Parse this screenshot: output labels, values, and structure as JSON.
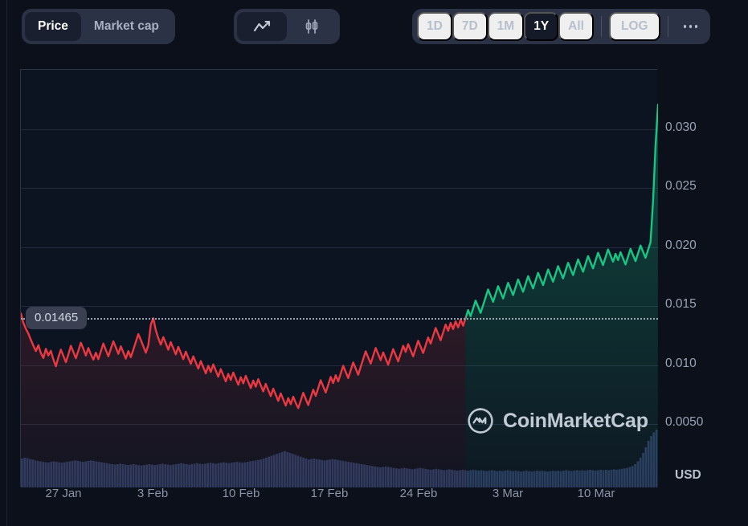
{
  "toolbar": {
    "metric_tabs": [
      {
        "label": "Price",
        "active": true
      },
      {
        "label": "Market cap",
        "active": false
      }
    ],
    "chart_type_icons": [
      {
        "name": "line-chart-icon",
        "active": true
      },
      {
        "name": "candlestick-chart-icon",
        "active": false
      }
    ],
    "ranges": [
      {
        "label": "1D",
        "active": false
      },
      {
        "label": "7D",
        "active": false
      },
      {
        "label": "1M",
        "active": false
      },
      {
        "label": "1Y",
        "active": true
      },
      {
        "label": "All",
        "active": false
      }
    ],
    "log_label": "LOG",
    "more_label": "more-options"
  },
  "chart_data": {
    "type": "line",
    "title": "",
    "xlabel": "",
    "ylabel": "USD",
    "currency": "USD",
    "ylim": [
      0.0025,
      0.0325
    ],
    "yticks": [
      "0.030",
      "0.025",
      "0.020",
      "0.015",
      "0.010",
      "0.0050"
    ],
    "ytick_values": [
      0.03,
      0.025,
      0.02,
      0.015,
      0.01,
      0.005
    ],
    "xticks": [
      "27 Jan",
      "3 Feb",
      "10 Feb",
      "17 Feb",
      "24 Feb",
      "3 Mar",
      "10 Mar"
    ],
    "grid": true,
    "legend": "none",
    "reference_line": {
      "label": "0.01465",
      "value": 0.01465,
      "style": "dotted"
    },
    "colors": {
      "up": "#16c784",
      "down": "#ea3943",
      "volume": "#2b3a5e",
      "plot_bg": "#0d1421",
      "page_bg": "#0b101b",
      "grid": "#212a3c",
      "axis_text": "#8b95a7"
    },
    "series": [
      {
        "name": "Price",
        "unit": "USD",
        "segment_split_value": 0.01465,
        "values": [
          0.015,
          0.01432,
          0.0139,
          0.01355,
          0.0131,
          0.01268,
          0.0123,
          0.01272,
          0.01215,
          0.0118,
          0.01246,
          0.01198,
          0.01232,
          0.0117,
          0.0112,
          0.01185,
          0.0124,
          0.01196,
          0.0115,
          0.01206,
          0.01268,
          0.01224,
          0.01178,
          0.01232,
          0.0129,
          0.01246,
          0.01198,
          0.01252,
          0.01206,
          0.01168,
          0.01218,
          0.01172,
          0.01228,
          0.01284,
          0.01238,
          0.01192,
          0.01246,
          0.013,
          0.01256,
          0.0121,
          0.01264,
          0.0122,
          0.01176,
          0.0123,
          0.01186,
          0.0124,
          0.01296,
          0.01352,
          0.0131,
          0.01264,
          0.01218,
          0.01272,
          0.0142,
          0.01466,
          0.0138,
          0.01322,
          0.01276,
          0.0133,
          0.01286,
          0.0124,
          0.01294,
          0.0125,
          0.01206,
          0.0126,
          0.01216,
          0.01172,
          0.01226,
          0.01182,
          0.01138,
          0.01192,
          0.01148,
          0.01104,
          0.01158,
          0.01114,
          0.0107,
          0.01124,
          0.0108,
          0.01134,
          0.0109,
          0.01046,
          0.011,
          0.01056,
          0.01012,
          0.01066,
          0.01022,
          0.01076,
          0.01032,
          0.00988,
          0.01042,
          0.00998,
          0.01052,
          0.01008,
          0.00964,
          0.01018,
          0.00974,
          0.01028,
          0.00984,
          0.0094,
          0.00994,
          0.0095,
          0.00906,
          0.0096,
          0.00916,
          0.00872,
          0.00926,
          0.00882,
          0.00838,
          0.00892,
          0.00848,
          0.00902,
          0.00858,
          0.0082,
          0.00874,
          0.0093,
          0.00886,
          0.00842,
          0.00896,
          0.00952,
          0.00908,
          0.00964,
          0.0102,
          0.00976,
          0.00932,
          0.00988,
          0.01044,
          0.01,
          0.01056,
          0.01012,
          0.01068,
          0.01124,
          0.0108,
          0.01036,
          0.01092,
          0.01148,
          0.01104,
          0.0106,
          0.01116,
          0.01172,
          0.01228,
          0.01184,
          0.0114,
          0.01196,
          0.01252,
          0.01208,
          0.01164,
          0.0122,
          0.01176,
          0.01132,
          0.01188,
          0.01244,
          0.012,
          0.01156,
          0.01212,
          0.01268,
          0.01224,
          0.0128,
          0.01236,
          0.01192,
          0.01248,
          0.01304,
          0.0126,
          0.01216,
          0.01272,
          0.01328,
          0.01284,
          0.0134,
          0.01396,
          0.01352,
          0.01308,
          0.01364,
          0.0142,
          0.01376,
          0.01432,
          0.01388,
          0.01444,
          0.014,
          0.01456,
          0.01412,
          0.01468,
          0.01524,
          0.0148,
          0.01536,
          0.01592,
          0.01548,
          0.01504,
          0.0156,
          0.01616,
          0.01672,
          0.01628,
          0.01584,
          0.0164,
          0.01696,
          0.01652,
          0.01608,
          0.01664,
          0.0172,
          0.01676,
          0.01632,
          0.01688,
          0.01744,
          0.017,
          0.01656,
          0.01712,
          0.01768,
          0.01724,
          0.0168,
          0.01736,
          0.01792,
          0.01748,
          0.01704,
          0.0176,
          0.01816,
          0.01772,
          0.01728,
          0.01784,
          0.0184,
          0.01796,
          0.01752,
          0.01808,
          0.01864,
          0.0182,
          0.01776,
          0.01832,
          0.01888,
          0.01844,
          0.018,
          0.01856,
          0.01912,
          0.01868,
          0.01824,
          0.0188,
          0.01936,
          0.01892,
          0.01848,
          0.01904,
          0.0196,
          0.01916,
          0.01872,
          0.01928,
          0.01884,
          0.0194,
          0.01896,
          0.01852,
          0.01908,
          0.01964,
          0.0192,
          0.01876,
          0.01932,
          0.01988,
          0.01944,
          0.019,
          0.01956,
          0.02012,
          0.023,
          0.027,
          0.03
        ]
      },
      {
        "name": "Volume",
        "values": [
          0.62,
          0.64,
          0.63,
          0.61,
          0.6,
          0.58,
          0.57,
          0.56,
          0.55,
          0.54,
          0.53,
          0.55,
          0.56,
          0.55,
          0.54,
          0.53,
          0.54,
          0.55,
          0.56,
          0.57,
          0.58,
          0.57,
          0.56,
          0.55,
          0.56,
          0.57,
          0.58,
          0.57,
          0.56,
          0.55,
          0.54,
          0.53,
          0.52,
          0.51,
          0.5,
          0.49,
          0.5,
          0.51,
          0.5,
          0.49,
          0.48,
          0.49,
          0.5,
          0.49,
          0.48,
          0.47,
          0.48,
          0.49,
          0.5,
          0.49,
          0.48,
          0.49,
          0.5,
          0.51,
          0.5,
          0.49,
          0.48,
          0.49,
          0.5,
          0.51,
          0.52,
          0.51,
          0.5,
          0.49,
          0.5,
          0.51,
          0.52,
          0.51,
          0.5,
          0.51,
          0.52,
          0.53,
          0.52,
          0.51,
          0.52,
          0.53,
          0.54,
          0.53,
          0.52,
          0.53,
          0.54,
          0.55,
          0.54,
          0.53,
          0.54,
          0.55,
          0.56,
          0.57,
          0.58,
          0.59,
          0.6,
          0.62,
          0.64,
          0.66,
          0.68,
          0.7,
          0.72,
          0.74,
          0.76,
          0.78,
          0.76,
          0.74,
          0.72,
          0.7,
          0.68,
          0.66,
          0.64,
          0.62,
          0.6,
          0.61,
          0.62,
          0.61,
          0.6,
          0.59,
          0.58,
          0.59,
          0.6,
          0.61,
          0.6,
          0.59,
          0.58,
          0.57,
          0.56,
          0.55,
          0.54,
          0.53,
          0.52,
          0.51,
          0.5,
          0.49,
          0.48,
          0.47,
          0.46,
          0.45,
          0.44,
          0.43,
          0.44,
          0.45,
          0.44,
          0.43,
          0.42,
          0.41,
          0.4,
          0.41,
          0.42,
          0.41,
          0.4,
          0.39,
          0.4,
          0.41,
          0.42,
          0.41,
          0.4,
          0.39,
          0.38,
          0.39,
          0.4,
          0.39,
          0.38,
          0.37,
          0.38,
          0.39,
          0.38,
          0.37,
          0.36,
          0.37,
          0.38,
          0.37,
          0.36,
          0.37,
          0.38,
          0.37,
          0.36,
          0.37,
          0.36,
          0.35,
          0.36,
          0.37,
          0.36,
          0.35,
          0.36,
          0.35,
          0.36,
          0.37,
          0.36,
          0.35,
          0.36,
          0.35,
          0.34,
          0.35,
          0.36,
          0.35,
          0.34,
          0.35,
          0.36,
          0.35,
          0.36,
          0.35,
          0.34,
          0.35,
          0.36,
          0.35,
          0.36,
          0.35,
          0.36,
          0.37,
          0.36,
          0.35,
          0.36,
          0.37,
          0.36,
          0.37,
          0.36,
          0.37,
          0.38,
          0.37,
          0.36,
          0.37,
          0.38,
          0.37,
          0.38,
          0.37,
          0.38,
          0.39,
          0.38,
          0.39,
          0.4,
          0.41,
          0.42,
          0.44,
          0.46,
          0.5,
          0.56,
          0.64,
          0.74,
          0.86,
          1.0,
          1.1,
          1.18,
          1.24
        ]
      }
    ]
  },
  "watermark": {
    "text": "CoinMarketCap",
    "icon": "coinmarketcap-logo-icon"
  }
}
